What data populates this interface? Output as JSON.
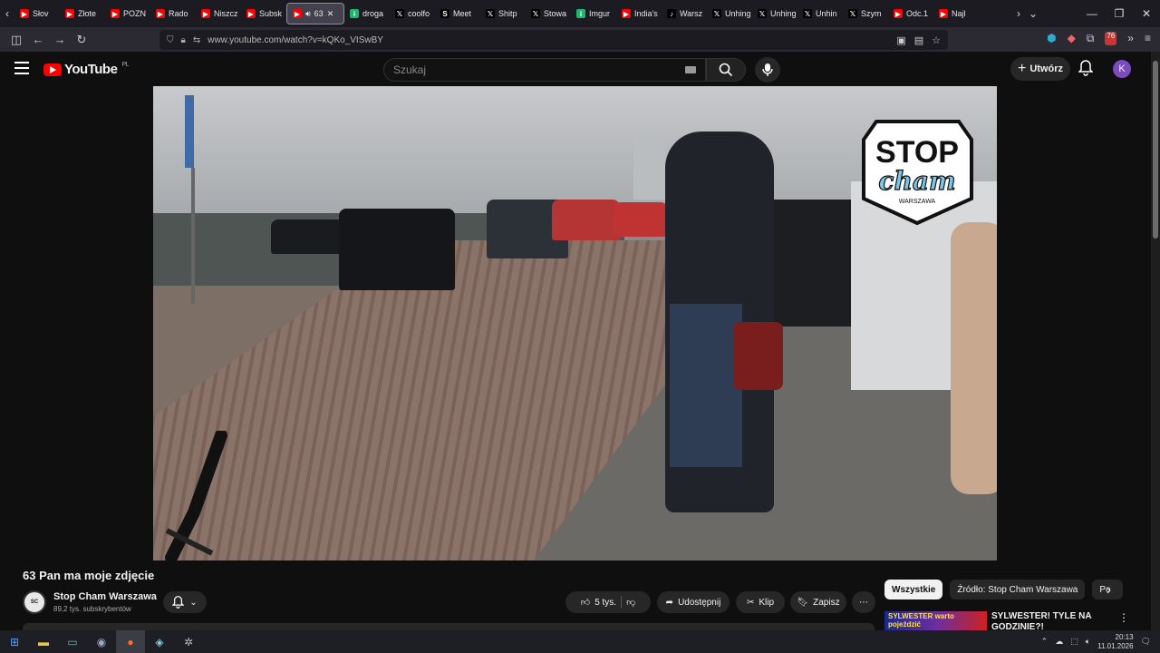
{
  "browser": {
    "tabs": [
      {
        "label": "Słov",
        "fav": "yt",
        "color": "#ff0000"
      },
      {
        "label": "Złote",
        "fav": "yt",
        "color": "#ff0000"
      },
      {
        "label": "POZN",
        "fav": "yt",
        "color": "#ff0000"
      },
      {
        "label": "Rado",
        "fav": "yt",
        "color": "#ff0000"
      },
      {
        "label": "Niszcz",
        "fav": "yt",
        "color": "#ff0000"
      },
      {
        "label": "Subsk",
        "fav": "yt",
        "color": "#ff0000"
      },
      {
        "label": "63",
        "fav": "yt",
        "color": "#ff0000",
        "active": true
      },
      {
        "label": "droga",
        "fav": "imgur",
        "color": "#1bb76e"
      },
      {
        "label": "coolfo",
        "fav": "x",
        "color": "#000000"
      },
      {
        "label": "Meet",
        "fav": "s",
        "color": "#000000"
      },
      {
        "label": "Shitp",
        "fav": "x",
        "color": "#000000"
      },
      {
        "label": "Stowa",
        "fav": "x",
        "color": "#000000"
      },
      {
        "label": "Imgur",
        "fav": "imgur",
        "color": "#1bb76e"
      },
      {
        "label": "India's",
        "fav": "yt",
        "color": "#ff0000"
      },
      {
        "label": "Warsz",
        "fav": "tiktok",
        "color": "#000000"
      },
      {
        "label": "Unhing",
        "fav": "x",
        "color": "#000000"
      },
      {
        "label": "Unhing",
        "fav": "x",
        "color": "#000000"
      },
      {
        "label": "Unhin",
        "fav": "x",
        "color": "#000000"
      },
      {
        "label": "Szym",
        "fav": "x",
        "color": "#000000"
      },
      {
        "label": "Odc.1",
        "fav": "yt",
        "color": "#ff0000"
      },
      {
        "label": "Najl",
        "fav": "yt",
        "color": "#ff0000"
      }
    ],
    "url": "www.youtube.com/watch?v=kQKo_VISwBY",
    "badge_count": "76"
  },
  "youtube": {
    "logo_text": "YouTube",
    "region": "PL",
    "search_placeholder": "Szukaj",
    "create_label": "Utwórz",
    "avatar_letter": "K"
  },
  "video": {
    "title": "63 Pan ma moje zdjęcie",
    "overlay_logo": {
      "top": "STOP",
      "middle": "cham",
      "bottom": "WARSZAWA"
    }
  },
  "channel": {
    "name": "Stop Cham Warszawa",
    "subscribers": "89,2 tys. subskrybentów"
  },
  "actions": {
    "likes": "5 tys.",
    "share": "Udostępnij",
    "clip": "Klip",
    "save": "Zapisz"
  },
  "sidebar": {
    "chips": [
      "Wszystkie",
      "Źródło: Stop Cham Warszawa",
      "Po"
    ],
    "rec_thumb_text": "SYLWESTER warto pojeździć",
    "rec_title": "SYLWESTER! TYLE NA GODZINIE?!"
  },
  "taskbar": {
    "time": "20:13",
    "date": "11.01.2026"
  }
}
